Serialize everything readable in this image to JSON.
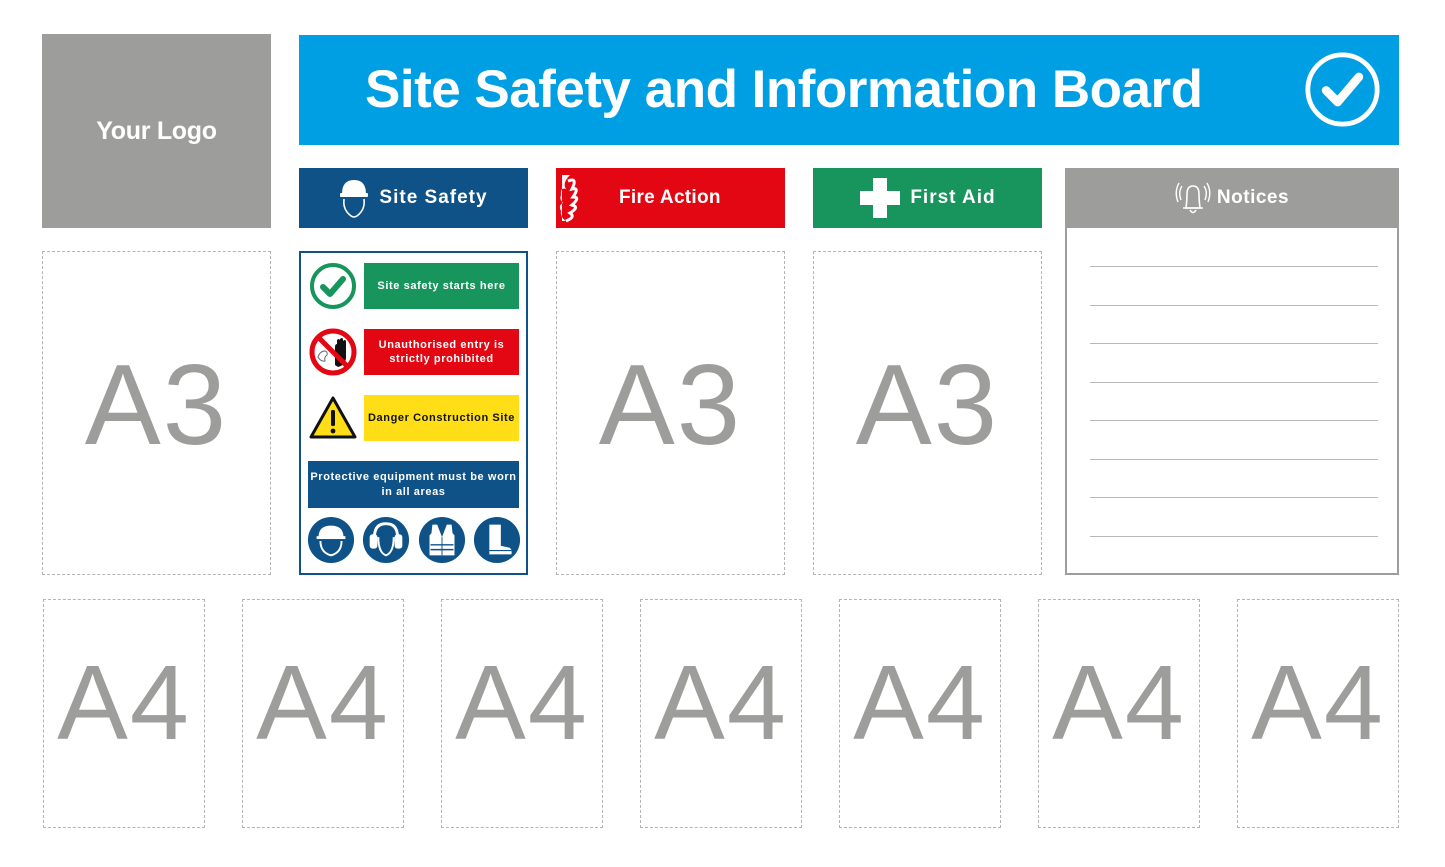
{
  "board": {
    "title": "Site Safety and Information Board",
    "title_icon": "check-circle-icon",
    "logo_placeholder": "Your Logo",
    "colors": {
      "title_blue": "#009fe3",
      "safety_blue": "#0f5287",
      "fire_red": "#e30613",
      "first_aid_green": "#17955c",
      "notice_grey": "#9d9d9c",
      "warning_yellow": "#ffde17"
    }
  },
  "sections": [
    {
      "label": "Site Safety",
      "icon": "hard-hat-head-icon"
    },
    {
      "label": "Fire Action",
      "icon": "flame-icon"
    },
    {
      "label": "First Aid",
      "icon": "first-aid-cross-icon"
    },
    {
      "label": "Notices",
      "icon": "ringing-bell-icon"
    }
  ],
  "safety_poster": {
    "rows": [
      {
        "icon": "check-circle-icon",
        "text": "Site safety starts here",
        "style": "green"
      },
      {
        "icon": "no-entry-hand-icon",
        "text": "Unauthorised entry is strictly prohibited",
        "style": "red"
      },
      {
        "icon": "warning-triangle-icon",
        "text": "Danger Construction Site",
        "style": "yellow"
      }
    ],
    "ppe_text": "Protective equipment must be worn in all areas",
    "ppe_icons": [
      "hard-hat-icon",
      "ear-defenders-icon",
      "hi-vis-vest-icon",
      "safety-boots-icon"
    ]
  },
  "slots": {
    "a3": [
      "A3",
      "A3",
      "A3"
    ],
    "a4": [
      "A4",
      "A4",
      "A4",
      "A4",
      "A4",
      "A4",
      "A4"
    ]
  },
  "notices": {
    "line_count": 8
  }
}
